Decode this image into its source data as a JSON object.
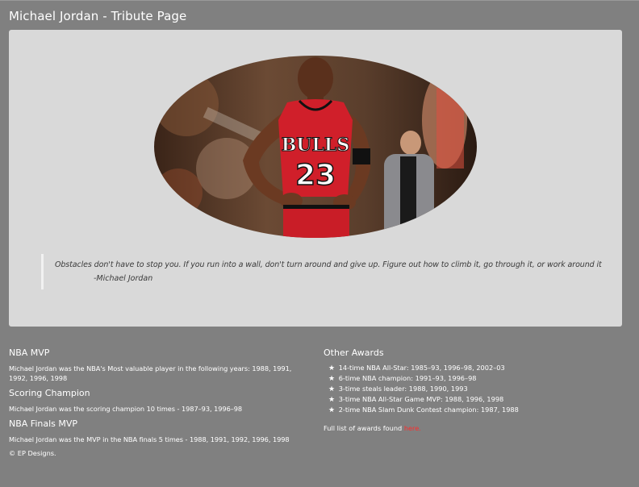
{
  "header": {
    "title": "Michael Jordan - Tribute Page"
  },
  "hero": {
    "image_alt": "Michael Jordan in Chicago Bulls #23 jersey",
    "jersey_team": "BULLS",
    "jersey_number": "23",
    "quote": "Obstacles don't have to stop you. If you run into a wall, don't turn around and give up. Figure out how to climb it, go through it, or work around it",
    "quote_author": "-Michael Jordan"
  },
  "sections": [
    {
      "heading": "NBA MVP",
      "text": "Michael Jordan was the NBA's Most valuable player in the following years: 1988, 1991, 1992, 1996, 1998"
    },
    {
      "heading": "Scoring Champion",
      "text": "Michael Jordan was the scoring champion 10 times - 1987–93, 1996–98"
    },
    {
      "heading": "NBA Finals MVP",
      "text": "Michael Jordan was the MVP in the NBA finals 5 times - 1988, 1991, 1992, 1996, 1998"
    }
  ],
  "footer": {
    "copyright": "© EP Designs."
  },
  "other_awards": {
    "heading": "Other Awards",
    "star_icon": "★",
    "items": [
      "14-time NBA All-Star: 1985–93, 1996–98, 2002–03",
      "6-time NBA champion: 1991–93, 1996–98",
      "3-time steals leader: 1988, 1990, 1993",
      "3-time NBA All-Star Game MVP: 1988, 1996, 1998",
      "2-time NBA Slam Dunk Contest champion: 1987, 1988"
    ],
    "full_list_prefix": "Full list of awards found ",
    "full_list_link": "here.",
    "link_color": "#ff2b2b"
  }
}
